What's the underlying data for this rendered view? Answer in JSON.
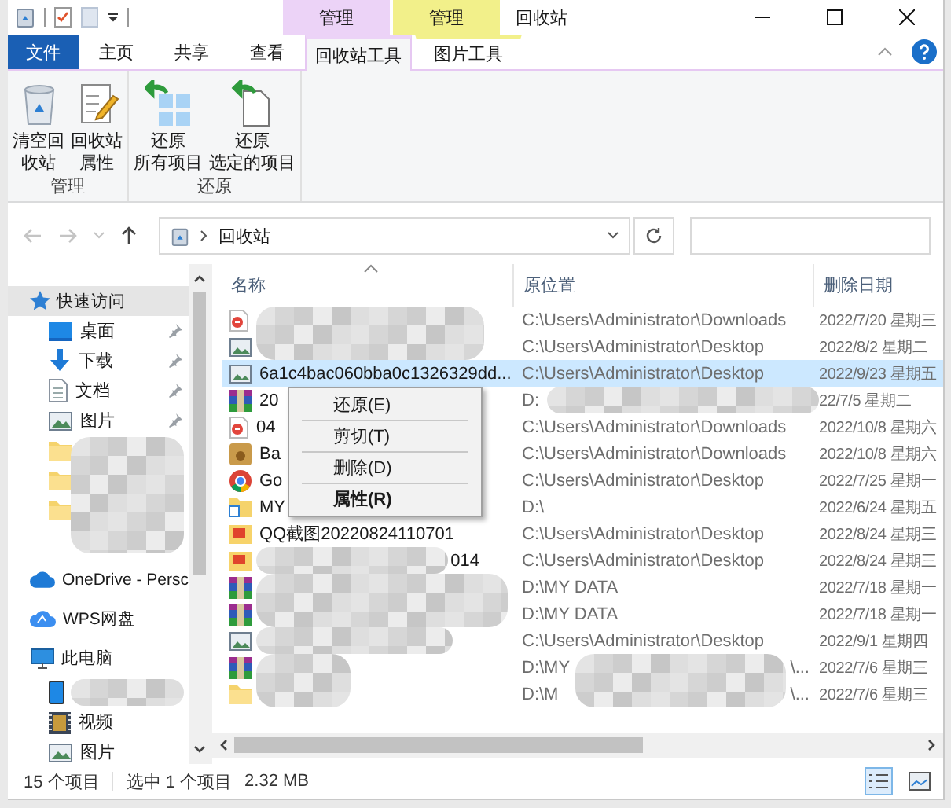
{
  "window": {
    "title": "回收站"
  },
  "ribbon_tabs": [
    {
      "label": "文件",
      "kind": "file",
      "selected": false
    },
    {
      "label": "主页",
      "kind": "plain",
      "selected": false
    },
    {
      "label": "共享",
      "kind": "plain",
      "selected": false
    },
    {
      "label": "查看",
      "kind": "plain",
      "selected": false
    },
    {
      "label": "回收站工具",
      "kind": "context",
      "context": "管理",
      "color": "#ecd3f7",
      "selected": true
    },
    {
      "label": "图片工具",
      "kind": "context",
      "context": "管理",
      "color": "#f2f08a",
      "selected": false
    }
  ],
  "ribbon_groups": [
    {
      "label": "管理",
      "buttons": [
        {
          "kind": "empty-bin",
          "lines": [
            "清空回",
            "收站"
          ]
        },
        {
          "kind": "properties",
          "lines": [
            "回收站",
            "属性"
          ]
        }
      ]
    },
    {
      "label": "还原",
      "buttons": [
        {
          "kind": "restore-all",
          "lines": [
            "还原",
            "所有项目"
          ]
        },
        {
          "kind": "restore-selected",
          "lines": [
            "还原",
            "选定的项目"
          ]
        }
      ]
    }
  ],
  "address": {
    "path": "回收站"
  },
  "sidebar": {
    "items": [
      {
        "kind": "star",
        "label": "快速访问",
        "selected": true,
        "children": [
          {
            "kind": "desktop",
            "label": "桌面",
            "pinned": true
          },
          {
            "kind": "download",
            "label": "下载",
            "pinned": true
          },
          {
            "kind": "document",
            "label": "文档",
            "pinned": true
          },
          {
            "kind": "pictures",
            "label": "图片",
            "pinned": true
          },
          {
            "kind": "folder",
            "pinned": false
          },
          {
            "kind": "folder",
            "pinned": false
          },
          {
            "kind": "folder",
            "pinned": false
          }
        ]
      },
      {
        "kind": "cloud",
        "label": "OneDrive - Persc",
        "selected": false
      },
      {
        "kind": "wps",
        "label": "WPS网盘",
        "selected": false
      },
      {
        "kind": "pc",
        "label": "此电脑",
        "selected": false,
        "children": [
          {
            "kind": "device",
            "pinned": false
          },
          {
            "kind": "video",
            "label": "视频",
            "pinned": false
          },
          {
            "kind": "pictures",
            "label": "图片",
            "pinned": false
          }
        ]
      }
    ]
  },
  "table": {
    "columns": [
      "名称",
      "原位置",
      "删除日期"
    ],
    "rows": [
      {
        "kind": "pdf",
        "location": "C:\\Users\\Administrator\\Downloads",
        "date": "2022/7/20 星期三",
        "selected": false
      },
      {
        "kind": "image",
        "location": "C:\\Users\\Administrator\\Desktop",
        "date": "2022/8/2 星期二",
        "selected": false
      },
      {
        "kind": "image",
        "name": "6a1c4bac060bba0c1326329dd...",
        "location": "C:\\Users\\Administrator\\Desktop",
        "date": "2022/9/23 星期五",
        "selected": true
      },
      {
        "kind": "archive",
        "name": "20",
        "location": "D:",
        "date": "22/7/5 星期二",
        "selected": false
      },
      {
        "kind": "pdf",
        "name": "04",
        "location": "C:\\Users\\Administrator\\Downloads",
        "date": "2022/10/8 星期六",
        "selected": false
      },
      {
        "kind": "baidu",
        "name": "Ba",
        "location": "C:\\Users\\Administrator\\Downloads",
        "date": "2022/10/8 星期六",
        "selected": false
      },
      {
        "kind": "browser",
        "name": "Go",
        "location": "C:\\Users\\Administrator\\Desktop",
        "date": "2022/7/25 星期一",
        "selected": false
      },
      {
        "kind": "folder-link",
        "name": "MY",
        "location": "D:\\",
        "date": "2022/6/24 星期五",
        "selected": false
      },
      {
        "kind": "screenshot",
        "name": "QQ截图20220824110701",
        "location": "C:\\Users\\Administrator\\Desktop",
        "date": "2022/8/24 星期三",
        "selected": false
      },
      {
        "kind": "screenshot",
        "name_tail": "014",
        "location": "C:\\Users\\Administrator\\Desktop",
        "date": "2022/8/24 星期三",
        "selected": false
      },
      {
        "kind": "archive",
        "location": "D:\\MY DATA",
        "date": "2022/7/18 星期一",
        "selected": false
      },
      {
        "kind": "archive",
        "location": "D:\\MY DATA",
        "date": "2022/7/18 星期一",
        "selected": false
      },
      {
        "kind": "image",
        "location": "C:\\Users\\Administrator\\Desktop",
        "date": "2022/9/1 星期四",
        "selected": false
      },
      {
        "kind": "archive",
        "location": "D:\\MY",
        "location_tail": "\\...",
        "date": "2022/7/6 星期三",
        "selected": false
      },
      {
        "kind": "folder",
        "location": "D:\\M",
        "location_tail": "\\...",
        "date": "2022/7/6 星期三",
        "selected": false
      }
    ]
  },
  "context_menu": {
    "items": [
      {
        "label": "还原(E)",
        "bold": false
      },
      {
        "label": "剪切(T)",
        "bold": false
      },
      {
        "label": "删除(D)",
        "bold": false
      },
      {
        "label": "属性(R)",
        "bold": true
      }
    ]
  },
  "status_bar": {
    "count": "15 个项目",
    "selection": "选中 1 个项目",
    "size": "2.32 MB"
  }
}
